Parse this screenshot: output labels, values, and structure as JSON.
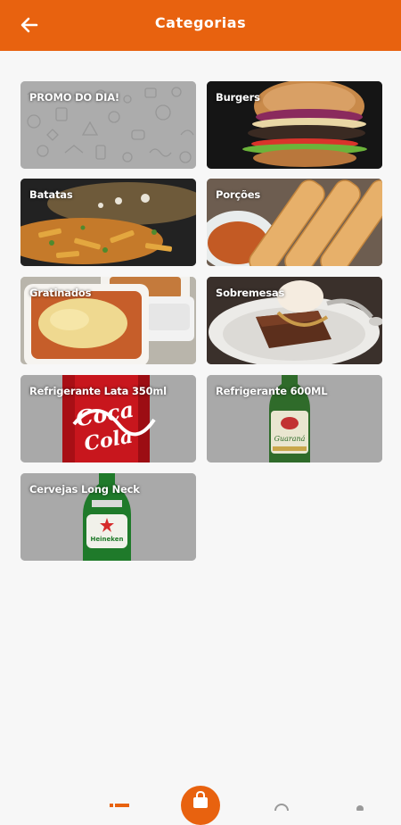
{
  "header": {
    "title": "Categorias",
    "back_icon": "arrow-left-icon",
    "color": "#e8620f"
  },
  "categories": [
    {
      "name": "PROMO DO DIA!",
      "art": "doodle-pattern"
    },
    {
      "name": "Burgers",
      "art": "burger-photo"
    },
    {
      "name": "Batatas",
      "art": "fries-photo"
    },
    {
      "name": "Porções",
      "art": "fried-sticks-photo"
    },
    {
      "name": "Gratinados",
      "art": "gratin-photo"
    },
    {
      "name": "Sobremesas",
      "art": "brownie-photo"
    },
    {
      "name": "Refrigerante Lata 350ml",
      "art": "coca-cola-can"
    },
    {
      "name": "Refrigerante 600ML",
      "art": "guarana-bottle"
    },
    {
      "name": "Cervejas Long Neck",
      "art": "heineken-bottle"
    }
  ],
  "bottom_nav": {
    "center_button_icon": "shopping-bag-icon",
    "icons": [
      "list-icon",
      "search-icon",
      "profile-icon"
    ]
  }
}
